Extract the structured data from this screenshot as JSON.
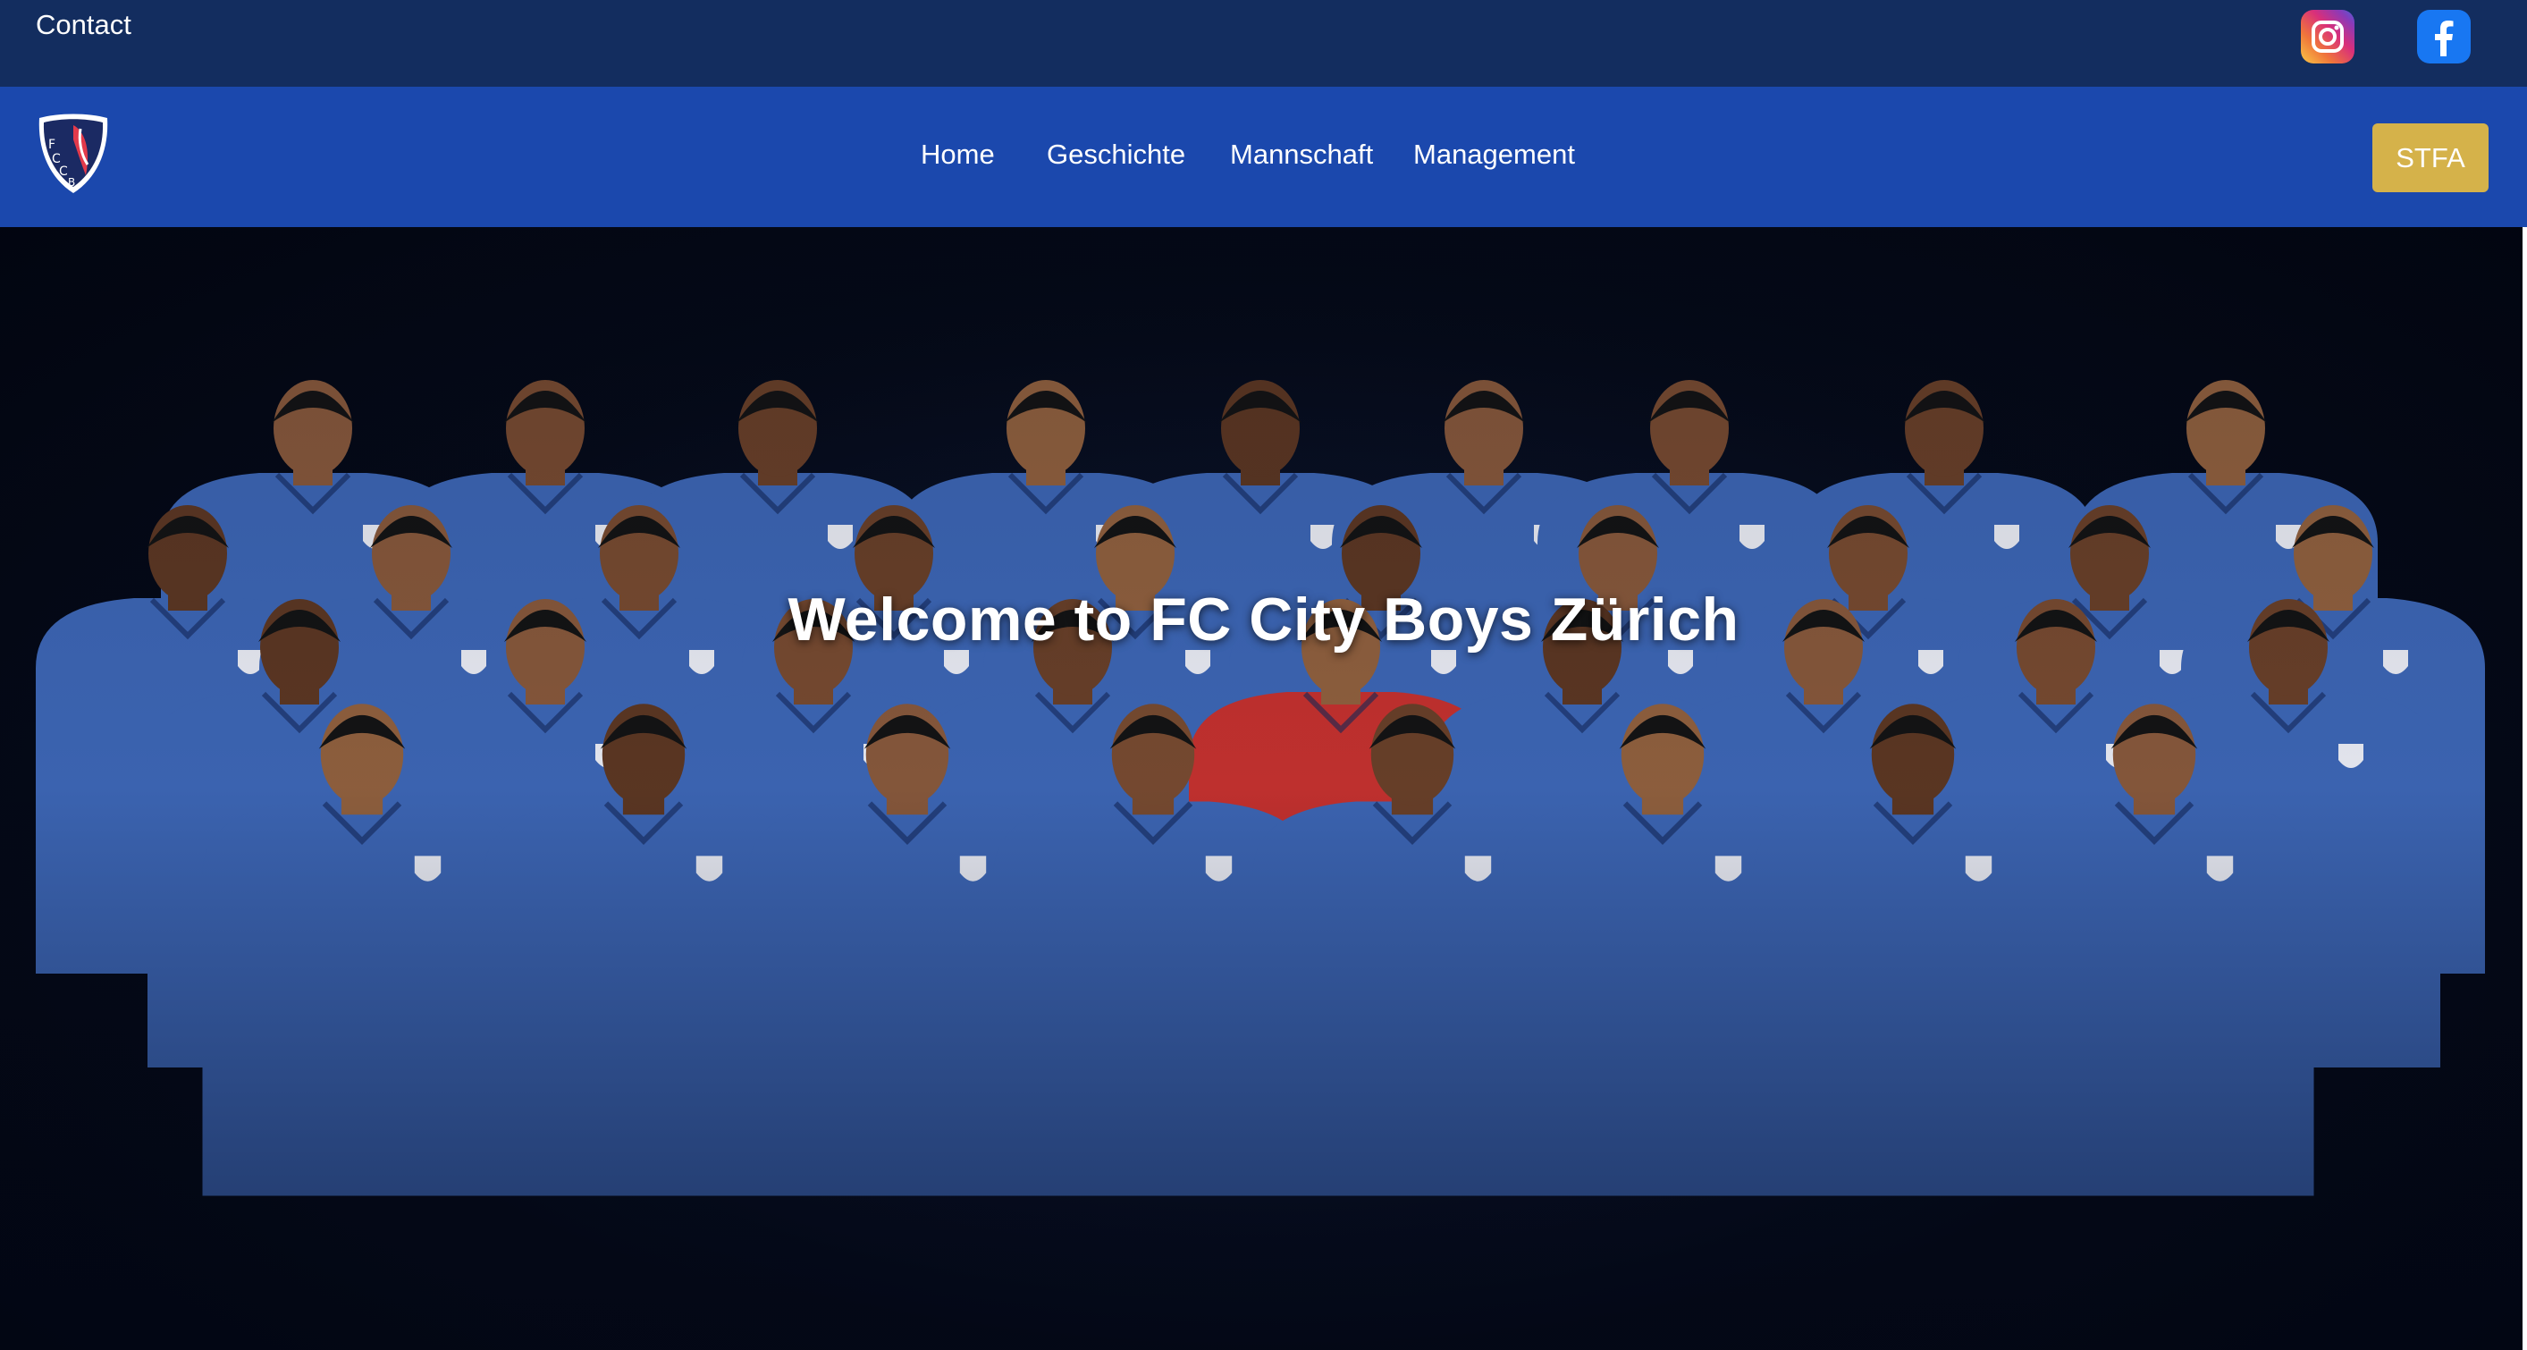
{
  "topbar": {
    "contact_label": "Contact",
    "social": [
      {
        "name": "instagram-icon"
      },
      {
        "name": "facebook-icon"
      }
    ]
  },
  "navbar": {
    "logo_text": "FCCB",
    "links": [
      "Home",
      "Geschichte",
      "Mannschaft",
      "Management"
    ],
    "cta_label": "STFA"
  },
  "hero": {
    "title": "Welcome to FC City Boys Zürich",
    "image_description_icon": "team-photo"
  },
  "colors": {
    "topbar": "#132d5f",
    "navbar": "#1b48ad",
    "cta": "#d5b24a",
    "jersey": "#3e68b8",
    "goalkeeper_jersey": "#c8322f"
  }
}
